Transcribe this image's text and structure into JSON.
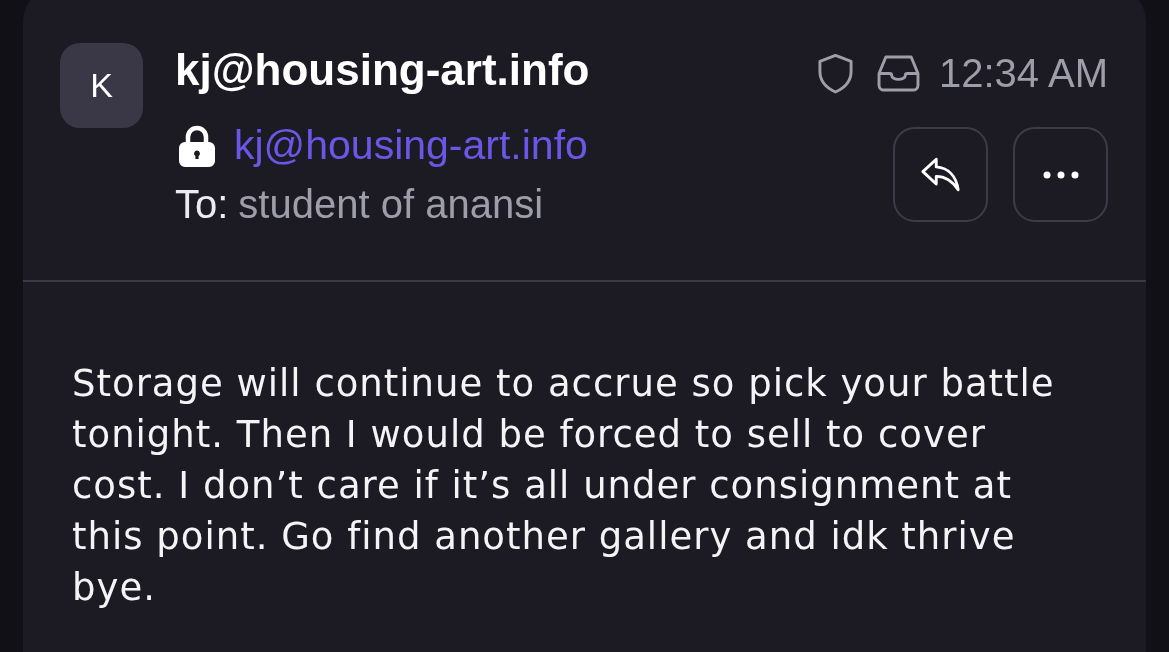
{
  "sender": {
    "avatar_initial": "K",
    "name": "kj@housing-art.info",
    "address": "kj@housing-art.info"
  },
  "recipient": {
    "label": "To:",
    "name": "student of anansi"
  },
  "meta": {
    "time": "12:34 AM"
  },
  "body": "Storage will continue to accrue so pick your battle tonight. Then I would be forced to sell to cover cost. I don’t care if it’s all under consignment at this point. Go find another gallery and idk thrive bye."
}
